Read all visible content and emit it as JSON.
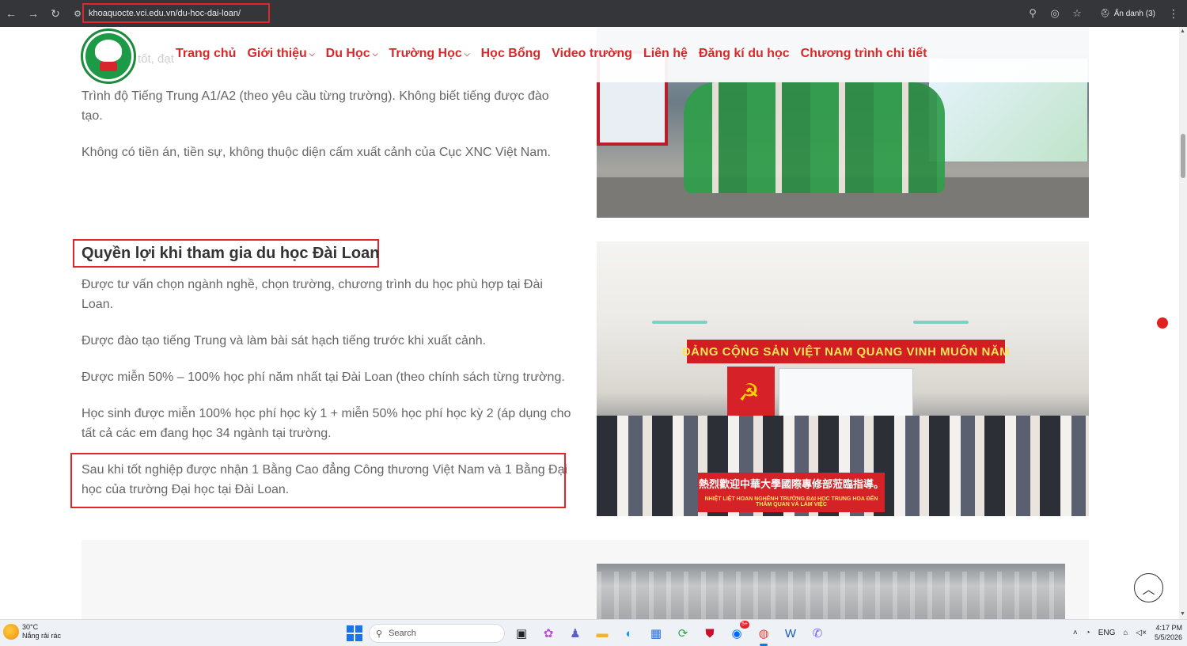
{
  "browser": {
    "url": "khoaquocte.vci.edu.vn/du-hoc-dai-loan/",
    "incognito_label": "Ẩn danh (3)"
  },
  "nav": {
    "items": [
      {
        "label": "Trang chủ",
        "has_dropdown": false
      },
      {
        "label": "Giới thiệu",
        "has_dropdown": true
      },
      {
        "label": "Du Học",
        "has_dropdown": true
      },
      {
        "label": "Trường Học",
        "has_dropdown": true
      },
      {
        "label": "Học Bổng",
        "has_dropdown": false
      },
      {
        "label": "Video trường",
        "has_dropdown": false
      },
      {
        "label": "Liên hệ",
        "has_dropdown": false
      },
      {
        "label": "Đăng kí du học",
        "has_dropdown": false
      },
      {
        "label": "Chương trình chi tiết",
        "has_dropdown": false
      }
    ]
  },
  "content": {
    "ghost_text": "tốt, đạt",
    "requirements": [
      "Trình độ Tiếng Trung A1/A2 (theo yêu cầu từng trường). Không biết tiếng được đào tạo.",
      "Không có tiền án, tiền sự, không thuộc diện cấm xuất cảnh của Cục XNC Việt Nam."
    ],
    "benefits_heading": "Quyền lợi khi tham gia du học Đài Loan",
    "benefits": [
      "Được tư vấn chọn ngành nghề, chọn trường, chương trình du học phù hợp tại Đài Loan.",
      "Được đào tạo tiếng Trung và làm bài sát hạch tiếng trước khi xuất cảnh.",
      "Được miễn 50% – 100% học phí năm nhất tại Đài Loan (theo chính sách từng trường.",
      "Học sinh được miễn 100% học phí học kỳ 1 + miễn 50% học phí học kỳ 2 (áp dụng cho tất cả các em đang học 34 ngành tại trường.",
      "Sau khi tốt nghiệp được nhận 1 Bằng Cao đẳng Công thương Việt Nam và 1 Bằng Đại học của trường Đại học tại Đài Loan."
    ],
    "photo2_banner": "ĐẢNG CỘNG SẢN VIỆT NAM QUANG VINH MUÔN NĂM",
    "photo2_sign_cn": "熱烈歡迎中華大學國際專修部蒞臨指導。",
    "photo2_sign_vn": "NHIỆT LIỆT HOAN NGHÊNH TRƯỜNG ĐẠI HỌC TRUNG HOA ĐẾN THĂM QUAN VÀ LÀM VIỆC"
  },
  "taskbar": {
    "weather_temp": "30°C",
    "weather_desc": "Nắng rải rác",
    "search_placeholder": "Search",
    "lang": "ENG",
    "time": "4:17 PM",
    "date": "5/5/2026",
    "zalo_badge": "5+"
  },
  "colors": {
    "brand_red": "#d62a2a",
    "highlight_border": "#e0262b",
    "chrome_bg": "#35363a"
  }
}
